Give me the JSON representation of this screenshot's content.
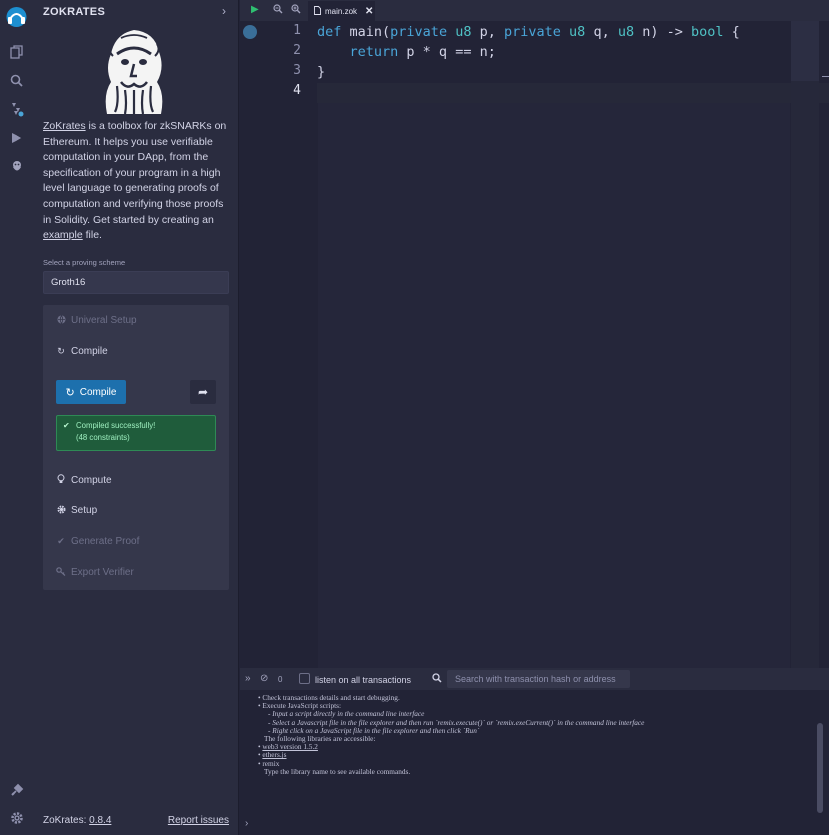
{
  "rail": {
    "icons": [
      "plugin-home-icon",
      "file-explorer-icon",
      "search-icon",
      "solidity-compiler-icon",
      "deploy-run-icon",
      "zokrates-plugin-icon",
      "plugin-manager-icon",
      "settings-icon"
    ]
  },
  "panel": {
    "title": "ZOKRATES",
    "chevron": "›",
    "description": {
      "link1": "ZoKrates",
      "text1": " is a toolbox for zkSNARKs on Ethereum. It helps you use verifiable computation in your DApp, from the specification of your program in a high level language to generating proofs of computation and verifying those proofs in Solidity. Get started by creating an ",
      "link2": "example",
      "text2": " file."
    },
    "scheme_label": "Select a proving scheme",
    "scheme_value": "Groth16",
    "steps": {
      "setup_universal": "Univeral Setup",
      "compile_header": "Compile",
      "compile_button": "Compile",
      "compute": "Compute",
      "setup": "Setup",
      "generate_proof": "Generate Proof",
      "export_verifier": "Export Verifier"
    },
    "success_line1": "Compiled successfully!",
    "success_line2": "(48 constraints)",
    "footer": {
      "version_label": "ZoKrates: ",
      "version": "0.8.4",
      "report": "Report issues"
    }
  },
  "editor": {
    "tab_name": "main.zok",
    "line_numbers": [
      "1",
      "2",
      "3",
      "4"
    ],
    "lines": [
      [
        {
          "t": "def",
          "c": "kw"
        },
        {
          "t": " main(",
          "c": ""
        },
        {
          "t": "private",
          "c": "kw"
        },
        {
          "t": " ",
          "c": ""
        },
        {
          "t": "u8",
          "c": "ty"
        },
        {
          "t": " p, ",
          "c": ""
        },
        {
          "t": "private",
          "c": "kw"
        },
        {
          "t": " ",
          "c": ""
        },
        {
          "t": "u8",
          "c": "ty"
        },
        {
          "t": " q, ",
          "c": ""
        },
        {
          "t": "u8",
          "c": "ty"
        },
        {
          "t": " n) -> ",
          "c": ""
        },
        {
          "t": "bool",
          "c": "ty"
        },
        {
          "t": " {",
          "c": ""
        }
      ],
      [
        {
          "t": "    ",
          "c": ""
        },
        {
          "t": "return",
          "c": "kw"
        },
        {
          "t": " p * q == n;",
          "c": ""
        }
      ],
      [
        {
          "t": "}",
          "c": ""
        }
      ],
      []
    ]
  },
  "terminal": {
    "count": "0",
    "listen_label": "listen on all transactions",
    "search_placeholder": "Search with transaction hash or address",
    "lines": [
      {
        "t": "• Check transactions details and start debugging.",
        "s": ""
      },
      {
        "t": "• Execute JavaScript scripts:",
        "s": ""
      },
      {
        "t": "- Input a script directly in the command line interface",
        "s": "it"
      },
      {
        "t": "- Select a Javascript file in the file explorer and then run `remix.execute()` or `remix.exeCurrent()`  in the command line interface",
        "s": "it"
      },
      {
        "t": "- Right click on a JavaScript file in the file explorer and then click `Run`",
        "s": "it"
      },
      {
        "t": " ",
        "s": ""
      },
      {
        "t": "The following libraries are accessible:",
        "s": "pad"
      },
      {
        "t": "• web3 version 1.5.2",
        "s": "u"
      },
      {
        "t": "• ethers.js",
        "s": "u"
      },
      {
        "t": "• remix",
        "s": ""
      },
      {
        "t": " ",
        "s": ""
      },
      {
        "t": "Type the library name to see available commands.",
        "s": "pad"
      }
    ],
    "prompt": "›"
  },
  "colors": {
    "background": "#222336",
    "panel": "#2a2c3f",
    "primary_button": "#1d70ad",
    "success_bg": "#1f5c3b",
    "keyword": "#4aa5d8",
    "type": "#4fc1c4"
  }
}
